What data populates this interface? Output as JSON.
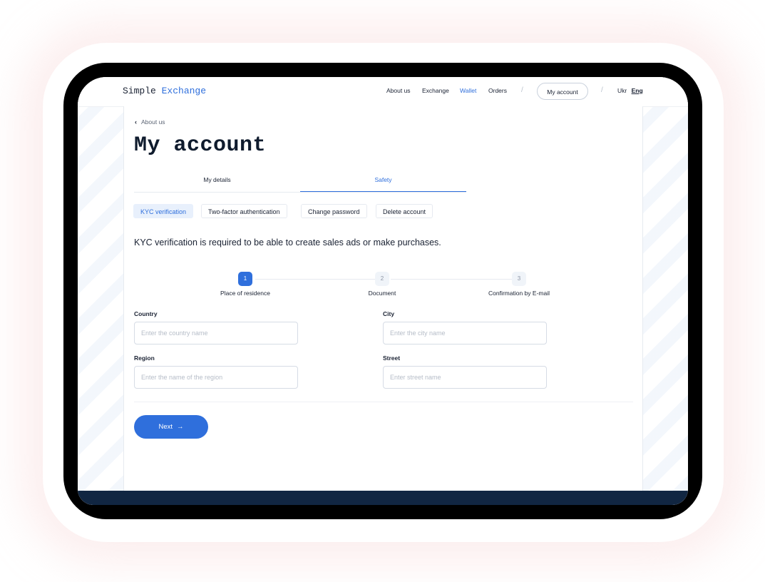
{
  "brand": {
    "word1": "Simple",
    "word2": "Exchange"
  },
  "nav": {
    "links": [
      "About us",
      "Exchange",
      "Wallet",
      "Orders"
    ],
    "active": "Wallet",
    "separator": "/",
    "account_button": "My account",
    "lang_ukr": "Ukr",
    "lang_eng": "Eng"
  },
  "page": {
    "back_label": "About us",
    "title": "My account",
    "tabs": [
      "My details",
      "Safety"
    ],
    "active_tab": "Safety",
    "subtabs": [
      "KYC verification",
      "Two-factor authentication",
      "Change password",
      "Delete account"
    ],
    "active_subtab": "KYC verification",
    "info_text": "KYC verification is required to be able to create sales ads or make purchases."
  },
  "steps": [
    {
      "number": "1",
      "label": "Place of residence",
      "active": true
    },
    {
      "number": "2",
      "label": "Document",
      "active": false
    },
    {
      "number": "3",
      "label": "Confirmation by E-mail",
      "active": false
    }
  ],
  "form": {
    "country": {
      "label": "Country",
      "placeholder": "Enter the country name",
      "value": ""
    },
    "city": {
      "label": "City",
      "placeholder": "Enter the city name",
      "value": ""
    },
    "region": {
      "label": "Region",
      "placeholder": "Enter the name of the region",
      "value": ""
    },
    "street": {
      "label": "Street",
      "placeholder": "Enter street name",
      "value": ""
    }
  },
  "next_button": {
    "label": "Next",
    "icon": "arrow-right-icon"
  },
  "colors": {
    "accent": "#2f6fdc",
    "footer": "#112642",
    "text": "#1a2233"
  }
}
